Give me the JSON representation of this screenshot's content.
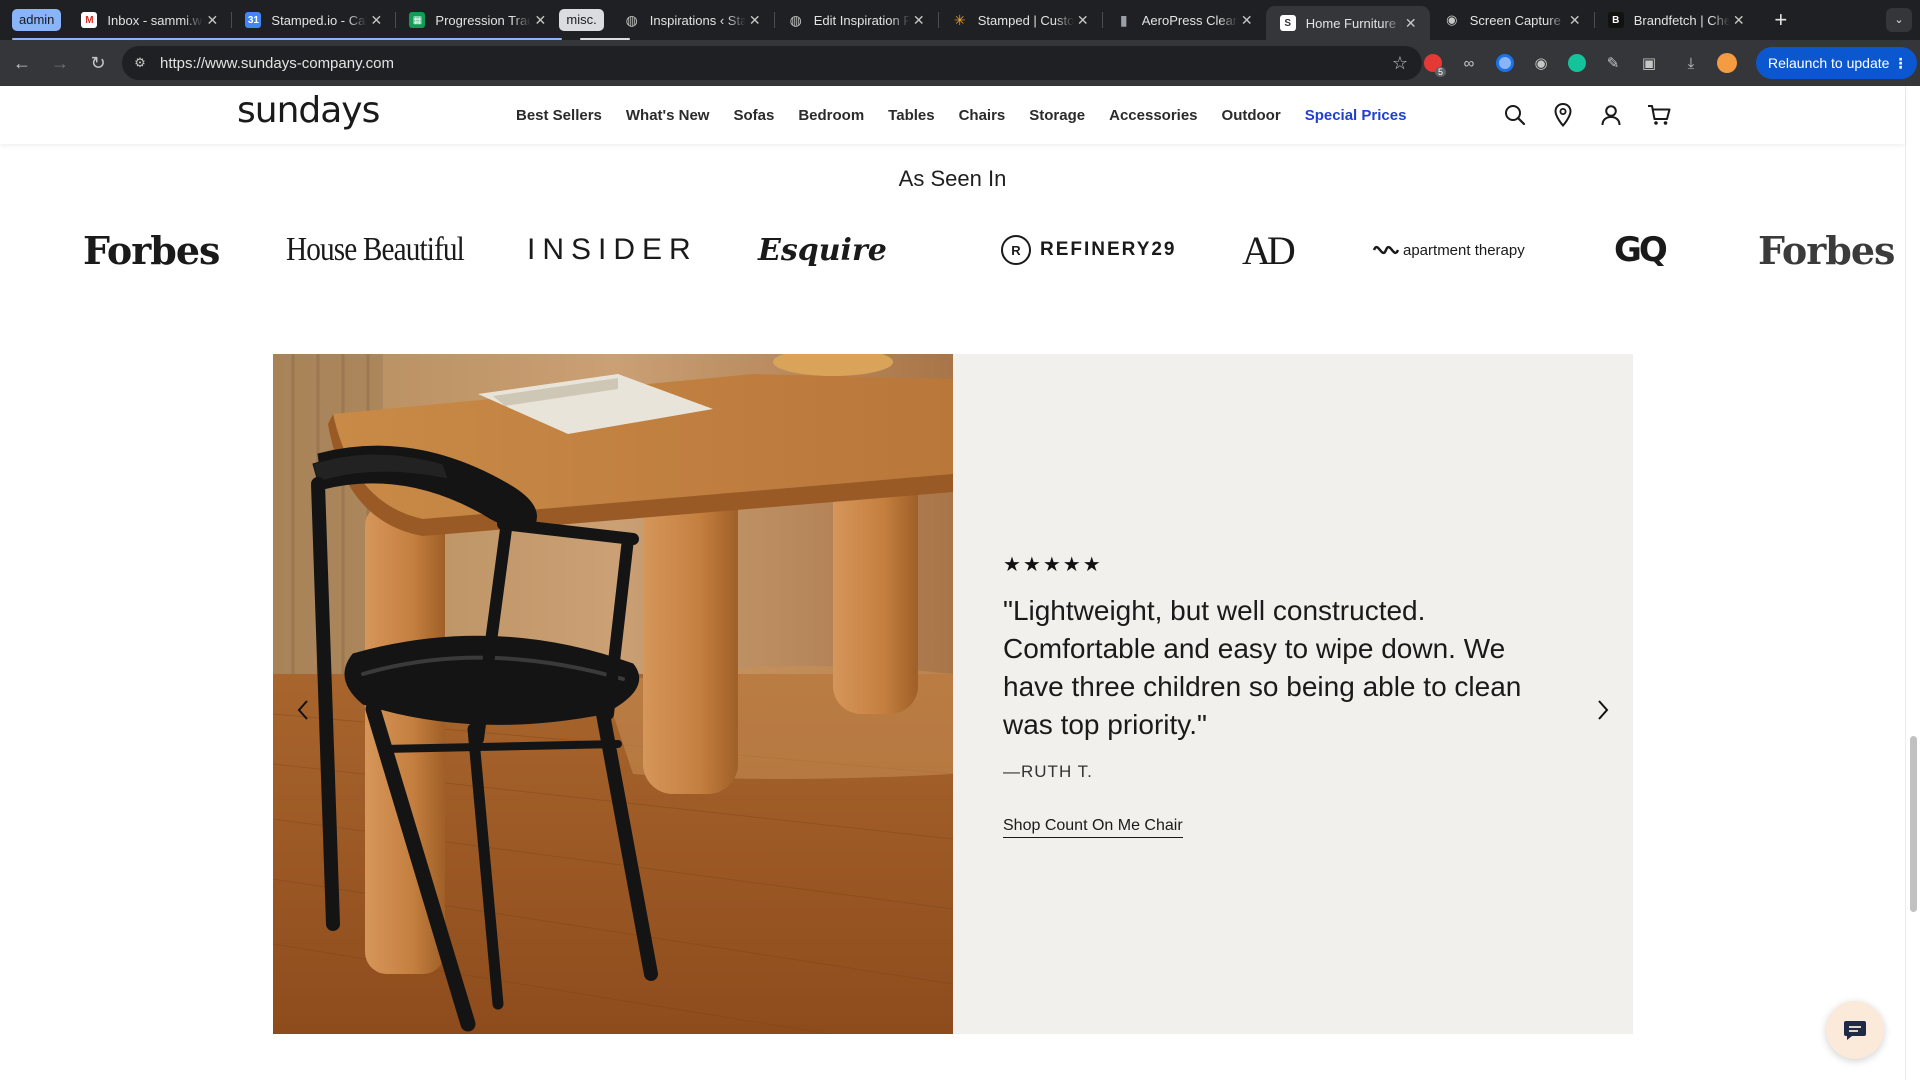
{
  "browser": {
    "tab_groups": {
      "admin": "admin",
      "misc": "misc."
    },
    "tabs": [
      {
        "title": "Inbox - sammi.w",
        "favicon": "gmail-icon"
      },
      {
        "title": "Stamped.io - Cal",
        "favicon": "calendar-icon"
      },
      {
        "title": "Progression Track",
        "favicon": "sheets-icon"
      },
      {
        "title": "Inspirations ‹ Sta",
        "favicon": "globe-icon"
      },
      {
        "title": "Edit Inspiration P",
        "favicon": "globe-icon"
      },
      {
        "title": "Stamped | Custo",
        "favicon": "stamped-icon"
      },
      {
        "title": "AeroPress Clear",
        "favicon": "aeropress-icon"
      },
      {
        "title": "Home Furniture S",
        "favicon": "sundays-icon",
        "active": true
      },
      {
        "title": "Screen Capture I",
        "favicon": "camera-icon"
      },
      {
        "title": "Brandfetch | Che",
        "favicon": "brandfetch-icon"
      }
    ],
    "url": "https://www.sundays-company.com",
    "relaunch_label": "Relaunch to update",
    "extension_badge": "5"
  },
  "site": {
    "logo": "sundays",
    "nav": [
      "Best Sellers",
      "What's New",
      "Sofas",
      "Bedroom",
      "Tables",
      "Chairs",
      "Storage",
      "Accessories",
      "Outdoor",
      "Special Prices"
    ],
    "special_color": "#1f3fd1",
    "header_icons": [
      "search-icon",
      "location-pin-icon",
      "account-icon",
      "cart-icon"
    ]
  },
  "as_seen_in": {
    "title": "As Seen In",
    "logos": [
      "Forbes",
      "House Beautiful",
      "INSIDER",
      "Esquire",
      "REFINERY29",
      "AD",
      "apartment therapy",
      "GQ",
      "Forbes"
    ]
  },
  "testimonial": {
    "rating": 5,
    "stars": "★★★★★",
    "quote": "\"Lightweight, but well constructed. Comfortable and easy to wipe down. We have three children so being able to clean was top priority.\"",
    "author": "—RUTH T.",
    "cta": "Shop Count On Me Chair",
    "panel_color": "#f2f0ec"
  }
}
